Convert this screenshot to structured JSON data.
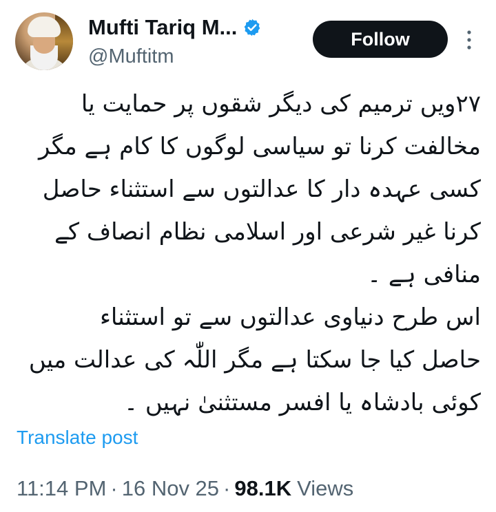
{
  "author": {
    "display_name": "Mufti Tariq M...",
    "handle": "@Muftitm",
    "verified_color": "#1d9bf0"
  },
  "actions": {
    "follow_label": "Follow",
    "more_icon": "more-vertical-icon"
  },
  "post": {
    "lines": [
      "۲۷ویں ترمیم کی دیگر شقوں پر حمایت یا",
      "مخالفت کرنا تو سیاسی لوگوں کا کام ہے مگر",
      "کسی عہدہ دار کا عدالتوں سے استثناء حاصل",
      "کرنا غیر شرعی اور اسلامی نظام انصاف کے",
      "منافی ہے ۔",
      "اس طرح دنیاوی عدالتوں سے تو استثناء",
      "حاصل کیا جا سکتا ہے مگر اللّٰہ کی عدالت میں",
      "کوئی بادشاہ یا افسر مستثنیٰ نہیں ۔"
    ],
    "translate_label": "Translate post",
    "time": "11:14 PM",
    "separator": "·",
    "date": "16 Nov 25",
    "views_count": "98.1K",
    "views_label": "Views"
  }
}
